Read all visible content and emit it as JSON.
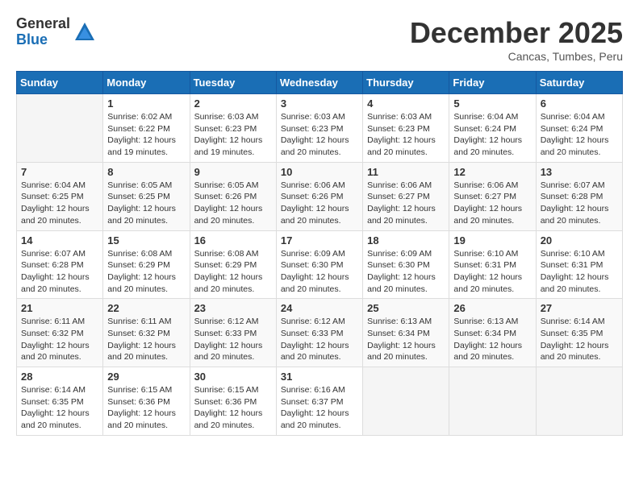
{
  "logo": {
    "general": "General",
    "blue": "Blue"
  },
  "header": {
    "month": "December 2025",
    "location": "Cancas, Tumbes, Peru"
  },
  "weekdays": [
    "Sunday",
    "Monday",
    "Tuesday",
    "Wednesday",
    "Thursday",
    "Friday",
    "Saturday"
  ],
  "weeks": [
    [
      {
        "day": "",
        "info": ""
      },
      {
        "day": "1",
        "info": "Sunrise: 6:02 AM\nSunset: 6:22 PM\nDaylight: 12 hours\nand 19 minutes."
      },
      {
        "day": "2",
        "info": "Sunrise: 6:03 AM\nSunset: 6:23 PM\nDaylight: 12 hours\nand 19 minutes."
      },
      {
        "day": "3",
        "info": "Sunrise: 6:03 AM\nSunset: 6:23 PM\nDaylight: 12 hours\nand 20 minutes."
      },
      {
        "day": "4",
        "info": "Sunrise: 6:03 AM\nSunset: 6:23 PM\nDaylight: 12 hours\nand 20 minutes."
      },
      {
        "day": "5",
        "info": "Sunrise: 6:04 AM\nSunset: 6:24 PM\nDaylight: 12 hours\nand 20 minutes."
      },
      {
        "day": "6",
        "info": "Sunrise: 6:04 AM\nSunset: 6:24 PM\nDaylight: 12 hours\nand 20 minutes."
      }
    ],
    [
      {
        "day": "7",
        "info": "Sunrise: 6:04 AM\nSunset: 6:25 PM\nDaylight: 12 hours\nand 20 minutes."
      },
      {
        "day": "8",
        "info": "Sunrise: 6:05 AM\nSunset: 6:25 PM\nDaylight: 12 hours\nand 20 minutes."
      },
      {
        "day": "9",
        "info": "Sunrise: 6:05 AM\nSunset: 6:26 PM\nDaylight: 12 hours\nand 20 minutes."
      },
      {
        "day": "10",
        "info": "Sunrise: 6:06 AM\nSunset: 6:26 PM\nDaylight: 12 hours\nand 20 minutes."
      },
      {
        "day": "11",
        "info": "Sunrise: 6:06 AM\nSunset: 6:27 PM\nDaylight: 12 hours\nand 20 minutes."
      },
      {
        "day": "12",
        "info": "Sunrise: 6:06 AM\nSunset: 6:27 PM\nDaylight: 12 hours\nand 20 minutes."
      },
      {
        "day": "13",
        "info": "Sunrise: 6:07 AM\nSunset: 6:28 PM\nDaylight: 12 hours\nand 20 minutes."
      }
    ],
    [
      {
        "day": "14",
        "info": "Sunrise: 6:07 AM\nSunset: 6:28 PM\nDaylight: 12 hours\nand 20 minutes."
      },
      {
        "day": "15",
        "info": "Sunrise: 6:08 AM\nSunset: 6:29 PM\nDaylight: 12 hours\nand 20 minutes."
      },
      {
        "day": "16",
        "info": "Sunrise: 6:08 AM\nSunset: 6:29 PM\nDaylight: 12 hours\nand 20 minutes."
      },
      {
        "day": "17",
        "info": "Sunrise: 6:09 AM\nSunset: 6:30 PM\nDaylight: 12 hours\nand 20 minutes."
      },
      {
        "day": "18",
        "info": "Sunrise: 6:09 AM\nSunset: 6:30 PM\nDaylight: 12 hours\nand 20 minutes."
      },
      {
        "day": "19",
        "info": "Sunrise: 6:10 AM\nSunset: 6:31 PM\nDaylight: 12 hours\nand 20 minutes."
      },
      {
        "day": "20",
        "info": "Sunrise: 6:10 AM\nSunset: 6:31 PM\nDaylight: 12 hours\nand 20 minutes."
      }
    ],
    [
      {
        "day": "21",
        "info": "Sunrise: 6:11 AM\nSunset: 6:32 PM\nDaylight: 12 hours\nand 20 minutes."
      },
      {
        "day": "22",
        "info": "Sunrise: 6:11 AM\nSunset: 6:32 PM\nDaylight: 12 hours\nand 20 minutes."
      },
      {
        "day": "23",
        "info": "Sunrise: 6:12 AM\nSunset: 6:33 PM\nDaylight: 12 hours\nand 20 minutes."
      },
      {
        "day": "24",
        "info": "Sunrise: 6:12 AM\nSunset: 6:33 PM\nDaylight: 12 hours\nand 20 minutes."
      },
      {
        "day": "25",
        "info": "Sunrise: 6:13 AM\nSunset: 6:34 PM\nDaylight: 12 hours\nand 20 minutes."
      },
      {
        "day": "26",
        "info": "Sunrise: 6:13 AM\nSunset: 6:34 PM\nDaylight: 12 hours\nand 20 minutes."
      },
      {
        "day": "27",
        "info": "Sunrise: 6:14 AM\nSunset: 6:35 PM\nDaylight: 12 hours\nand 20 minutes."
      }
    ],
    [
      {
        "day": "28",
        "info": "Sunrise: 6:14 AM\nSunset: 6:35 PM\nDaylight: 12 hours\nand 20 minutes."
      },
      {
        "day": "29",
        "info": "Sunrise: 6:15 AM\nSunset: 6:36 PM\nDaylight: 12 hours\nand 20 minutes."
      },
      {
        "day": "30",
        "info": "Sunrise: 6:15 AM\nSunset: 6:36 PM\nDaylight: 12 hours\nand 20 minutes."
      },
      {
        "day": "31",
        "info": "Sunrise: 6:16 AM\nSunset: 6:37 PM\nDaylight: 12 hours\nand 20 minutes."
      },
      {
        "day": "",
        "info": ""
      },
      {
        "day": "",
        "info": ""
      },
      {
        "day": "",
        "info": ""
      }
    ]
  ]
}
